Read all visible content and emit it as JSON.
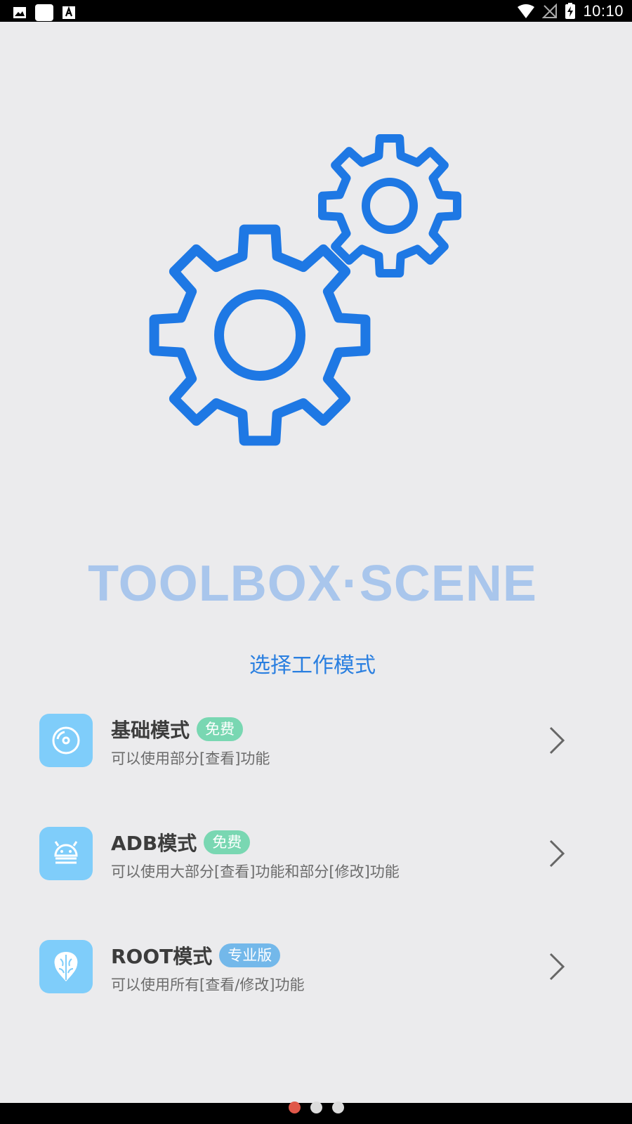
{
  "status_bar": {
    "time": "10:10"
  },
  "app": {
    "title": "TOOLBOX·SCENE",
    "subtitle": "选择工作模式"
  },
  "modes": [
    {
      "title": "基础模式",
      "badge": "免费",
      "desc": "可以使用部分[查看]功能",
      "icon": "disc-icon"
    },
    {
      "title": "ADB模式",
      "badge": "免费",
      "desc": "可以使用大部分[查看]功能和部分[修改]功能",
      "icon": "android-icon"
    },
    {
      "title": "ROOT模式",
      "badge": "专业版",
      "desc": "可以使用所有[查看/修改]功能",
      "icon": "brain-icon"
    }
  ],
  "pager": {
    "count": 3,
    "active": 0
  },
  "colors": {
    "accent": "#2a7fe0",
    "gear": "#1e78e4",
    "badge_free": "#79d7b2",
    "badge_pro": "#73b8ea",
    "active_dot": "#e0584a"
  }
}
